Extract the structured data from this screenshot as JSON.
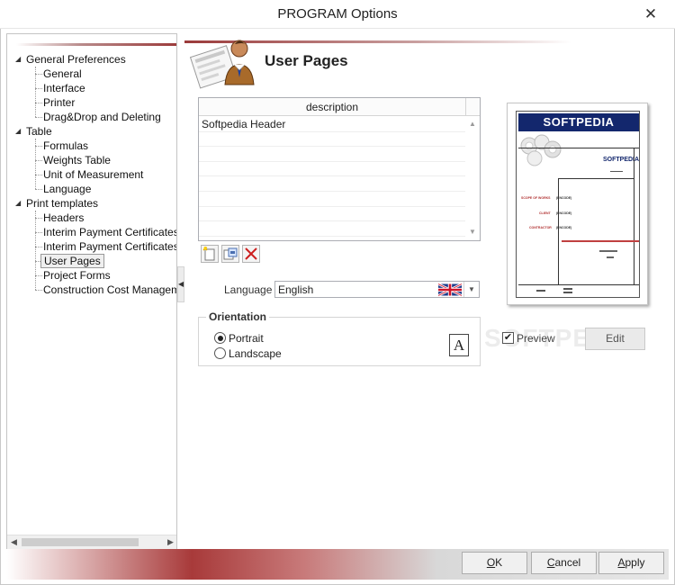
{
  "window": {
    "title": "PROGRAM Options",
    "close_glyph": "✕"
  },
  "tree": {
    "nodes": [
      {
        "label": "General Preferences",
        "level": 0,
        "toggle": "◢"
      },
      {
        "label": "General",
        "level": 1
      },
      {
        "label": "Interface",
        "level": 1
      },
      {
        "label": "Printer",
        "level": 1
      },
      {
        "label": "Drag&Drop and Deleting",
        "level": 1
      },
      {
        "label": "Table",
        "level": 0,
        "toggle": "◢"
      },
      {
        "label": "Formulas",
        "level": 1
      },
      {
        "label": "Weights Table",
        "level": 1
      },
      {
        "label": "Unit of Measurement",
        "level": 1
      },
      {
        "label": "Language",
        "level": 1
      },
      {
        "label": "Print templates",
        "level": 0,
        "toggle": "◢"
      },
      {
        "label": "Headers",
        "level": 1
      },
      {
        "label": "Interim Payment Certificates",
        "level": 1
      },
      {
        "label": "Interim Payment Certificates (E",
        "level": 1
      },
      {
        "label": "User Pages",
        "level": 1,
        "selected": true
      },
      {
        "label": "Project Forms",
        "level": 1
      },
      {
        "label": "Construction Cost Managemen",
        "level": 1
      }
    ],
    "scroll_left": "◀",
    "scroll_right": "▶"
  },
  "splitter_glyph": "◀",
  "page": {
    "title": "User Pages"
  },
  "grid": {
    "column_header": "description",
    "rows": [
      "Softpedia Header",
      "",
      "",
      "",
      "",
      "",
      "",
      ""
    ],
    "scroll_up": "▲",
    "scroll_down": "▼"
  },
  "language": {
    "label": "Language",
    "value": "English",
    "dropdown_glyph": "▼"
  },
  "orientation": {
    "legend": "Orientation",
    "options": [
      "Portrait",
      "Landscape"
    ],
    "selected": "Portrait",
    "icon_letter": "A"
  },
  "preview": {
    "logo_text": "SOFTPEDIA",
    "header_right": "SOFTPEDIA",
    "labels": [
      "SCOPE OF WORKS",
      "CLIENT",
      "CONTRACTOR"
    ],
    "values": [
      "(ENCODE)",
      "(ENCODE)",
      "(ENCODE)"
    ],
    "checkbox_label": "Preview",
    "checked": true,
    "check_glyph": "✔",
    "edit_label": "Edit"
  },
  "watermark": "SOFTPEDIA",
  "buttons": {
    "ok_first": "O",
    "ok_rest": "K",
    "cancel_first": "C",
    "cancel_rest": "ancel",
    "apply_first": "A",
    "apply_rest": "pply"
  },
  "colors": {
    "accent_red": "#a83a3a",
    "logo_blue": "#13276d",
    "delete_red": "#cc1f1f"
  }
}
